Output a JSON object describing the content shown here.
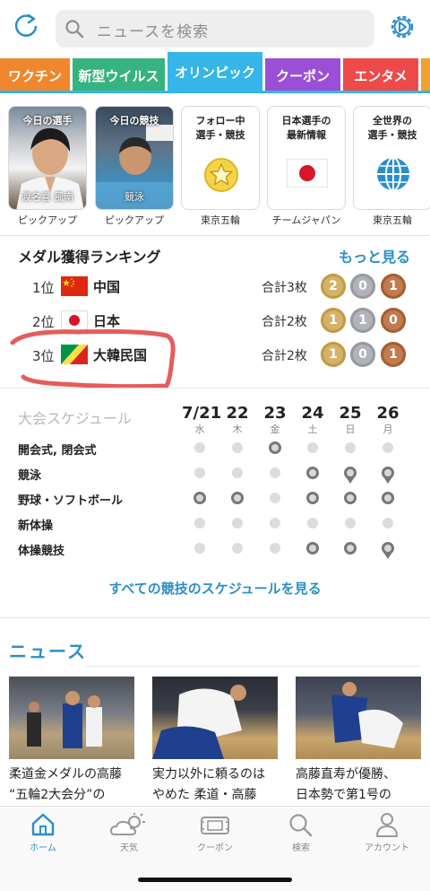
{
  "search": {
    "placeholder": "ニュースを検索"
  },
  "tabs": [
    {
      "label": "ワクチン",
      "color": "#f0872e"
    },
    {
      "label": "新型ウイルス",
      "color": "#36b37e"
    },
    {
      "label": "オリンピック",
      "color": "#35b5e8",
      "active": true
    },
    {
      "label": "クーポン",
      "color": "#9b4fd6"
    },
    {
      "label": "エンタメ",
      "color": "#ef4a4a"
    }
  ],
  "cards": [
    {
      "title": "今日の選手",
      "caption": "渡名喜 風南",
      "sub": "ピックアップ"
    },
    {
      "title": "今日の競技",
      "caption": "競泳",
      "sub": "ピックアップ"
    },
    {
      "title": "フォロー中\n選手・競技",
      "sub": "東京五輪"
    },
    {
      "title": "日本選手の\n最新情報",
      "sub": "チームジャパン"
    },
    {
      "title": "全世界の\n選手・競技",
      "sub": "東京五輪"
    }
  ],
  "medals": {
    "title": "メダル獲得ランキング",
    "more": "もっと見る",
    "rows": [
      {
        "rank": "1位",
        "country": "中国",
        "total": "合計3枚",
        "gold": "2",
        "silver": "0",
        "bronze": "1"
      },
      {
        "rank": "2位",
        "country": "日本",
        "total": "合計2枚",
        "gold": "1",
        "silver": "1",
        "bronze": "0"
      },
      {
        "rank": "3位",
        "country": "大韓民国",
        "total": "合計2枚",
        "gold": "1",
        "silver": "0",
        "bronze": "1"
      }
    ]
  },
  "schedule": {
    "title": "大会スケジュール",
    "dates": [
      {
        "num": "7/21",
        "day": "水"
      },
      {
        "num": "22",
        "day": "木"
      },
      {
        "num": "23",
        "day": "金"
      },
      {
        "num": "24",
        "day": "土"
      },
      {
        "num": "25",
        "day": "日"
      },
      {
        "num": "26",
        "day": "月"
      }
    ],
    "sports": [
      {
        "name": "開会式, 閉会式",
        "marks": [
          "dot",
          "dot",
          "ring",
          "dot",
          "dot",
          "dot"
        ]
      },
      {
        "name": "競泳",
        "marks": [
          "dot",
          "dot",
          "dot",
          "ring",
          "medal",
          "medal"
        ]
      },
      {
        "name": "野球・ソフトボール",
        "marks": [
          "ring",
          "ring",
          "dot",
          "ring",
          "ring",
          "ring"
        ]
      },
      {
        "name": "新体操",
        "marks": [
          "dot",
          "dot",
          "dot",
          "dot",
          "dot",
          "dot"
        ]
      },
      {
        "name": "体操競技",
        "marks": [
          "dot",
          "dot",
          "dot",
          "ring",
          "ring",
          "medal"
        ]
      }
    ],
    "all_link": "すべての競技のスケジュールを見る"
  },
  "news": {
    "title": "ニュース",
    "items": [
      {
        "text": "柔道金メダルの高藤\n“五輪2大会分”の"
      },
      {
        "text": "実力以外に頼るのは\nやめた 柔道・高藤"
      },
      {
        "text": "高藤直寿が優勝、\n日本勢で第1号の"
      }
    ]
  },
  "tabbar": [
    {
      "label": "ホーム",
      "active": true
    },
    {
      "label": "天気"
    },
    {
      "label": "クーポン"
    },
    {
      "label": "検索"
    },
    {
      "label": "アカウント"
    }
  ]
}
